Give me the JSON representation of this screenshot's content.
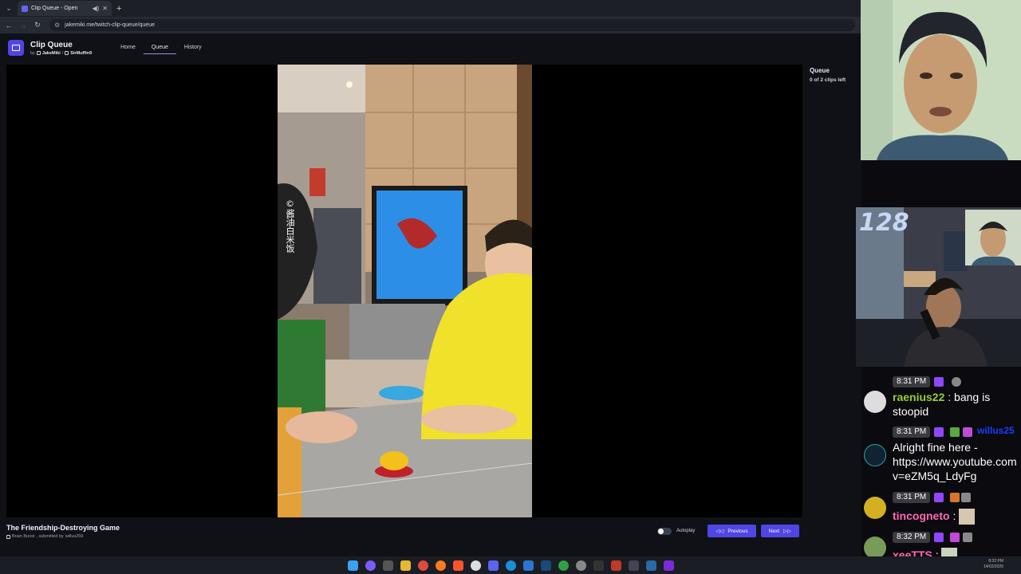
{
  "browser": {
    "tab_title": "Clip Queue - Open",
    "url": "jakemiki.me/twitch-clip-queue/queue"
  },
  "app": {
    "title": "Clip Queue",
    "by": "by",
    "author": "JakeMiki",
    "separator": "/",
    "channel": "SirMuffin9",
    "nav": [
      "Home",
      "Queue",
      "History"
    ],
    "active_nav": "Queue"
  },
  "queue": {
    "title": "Queue",
    "count": "0 of 2 clips left"
  },
  "clip": {
    "title": "The Friendship-Destroying Game",
    "category": "Brain Boost",
    "submitted_prefix": ", submitted by",
    "submitter": "willus259",
    "watermark": "©酱油白米饭"
  },
  "controls": {
    "autoplay_label": "Autoplay",
    "autoplay_on": false,
    "previous_label": "Previous",
    "next_label": "Next"
  },
  "stream": {
    "viewer_count": "128"
  },
  "chat": [
    {
      "time": "8:31 PM",
      "user": "raenius22",
      "user_color": "#9acd32",
      "text_line1": "bang is",
      "text_line2": "stoopid"
    },
    {
      "time": "8:31 PM",
      "user": "willus25",
      "user_color": "#1e3cff",
      "text_line1": "Alright fine here -",
      "text_line2": "https://www.youtube.com",
      "text_line3": "v=eZM5q_LdyFg"
    },
    {
      "time": "8:31 PM",
      "user": "tincogneto",
      "user_color": "#ff69b4",
      "text_line1": ":"
    },
    {
      "time": "8:32 PM",
      "user": "xeeTTS",
      "user_color": "#ff69b4",
      "text_line1": ":"
    }
  ],
  "taskbar": {
    "time": "8:32 PM",
    "date": "14/02/2026"
  },
  "colors": {
    "accent": "#4f46e5",
    "background": "#0f1116"
  }
}
